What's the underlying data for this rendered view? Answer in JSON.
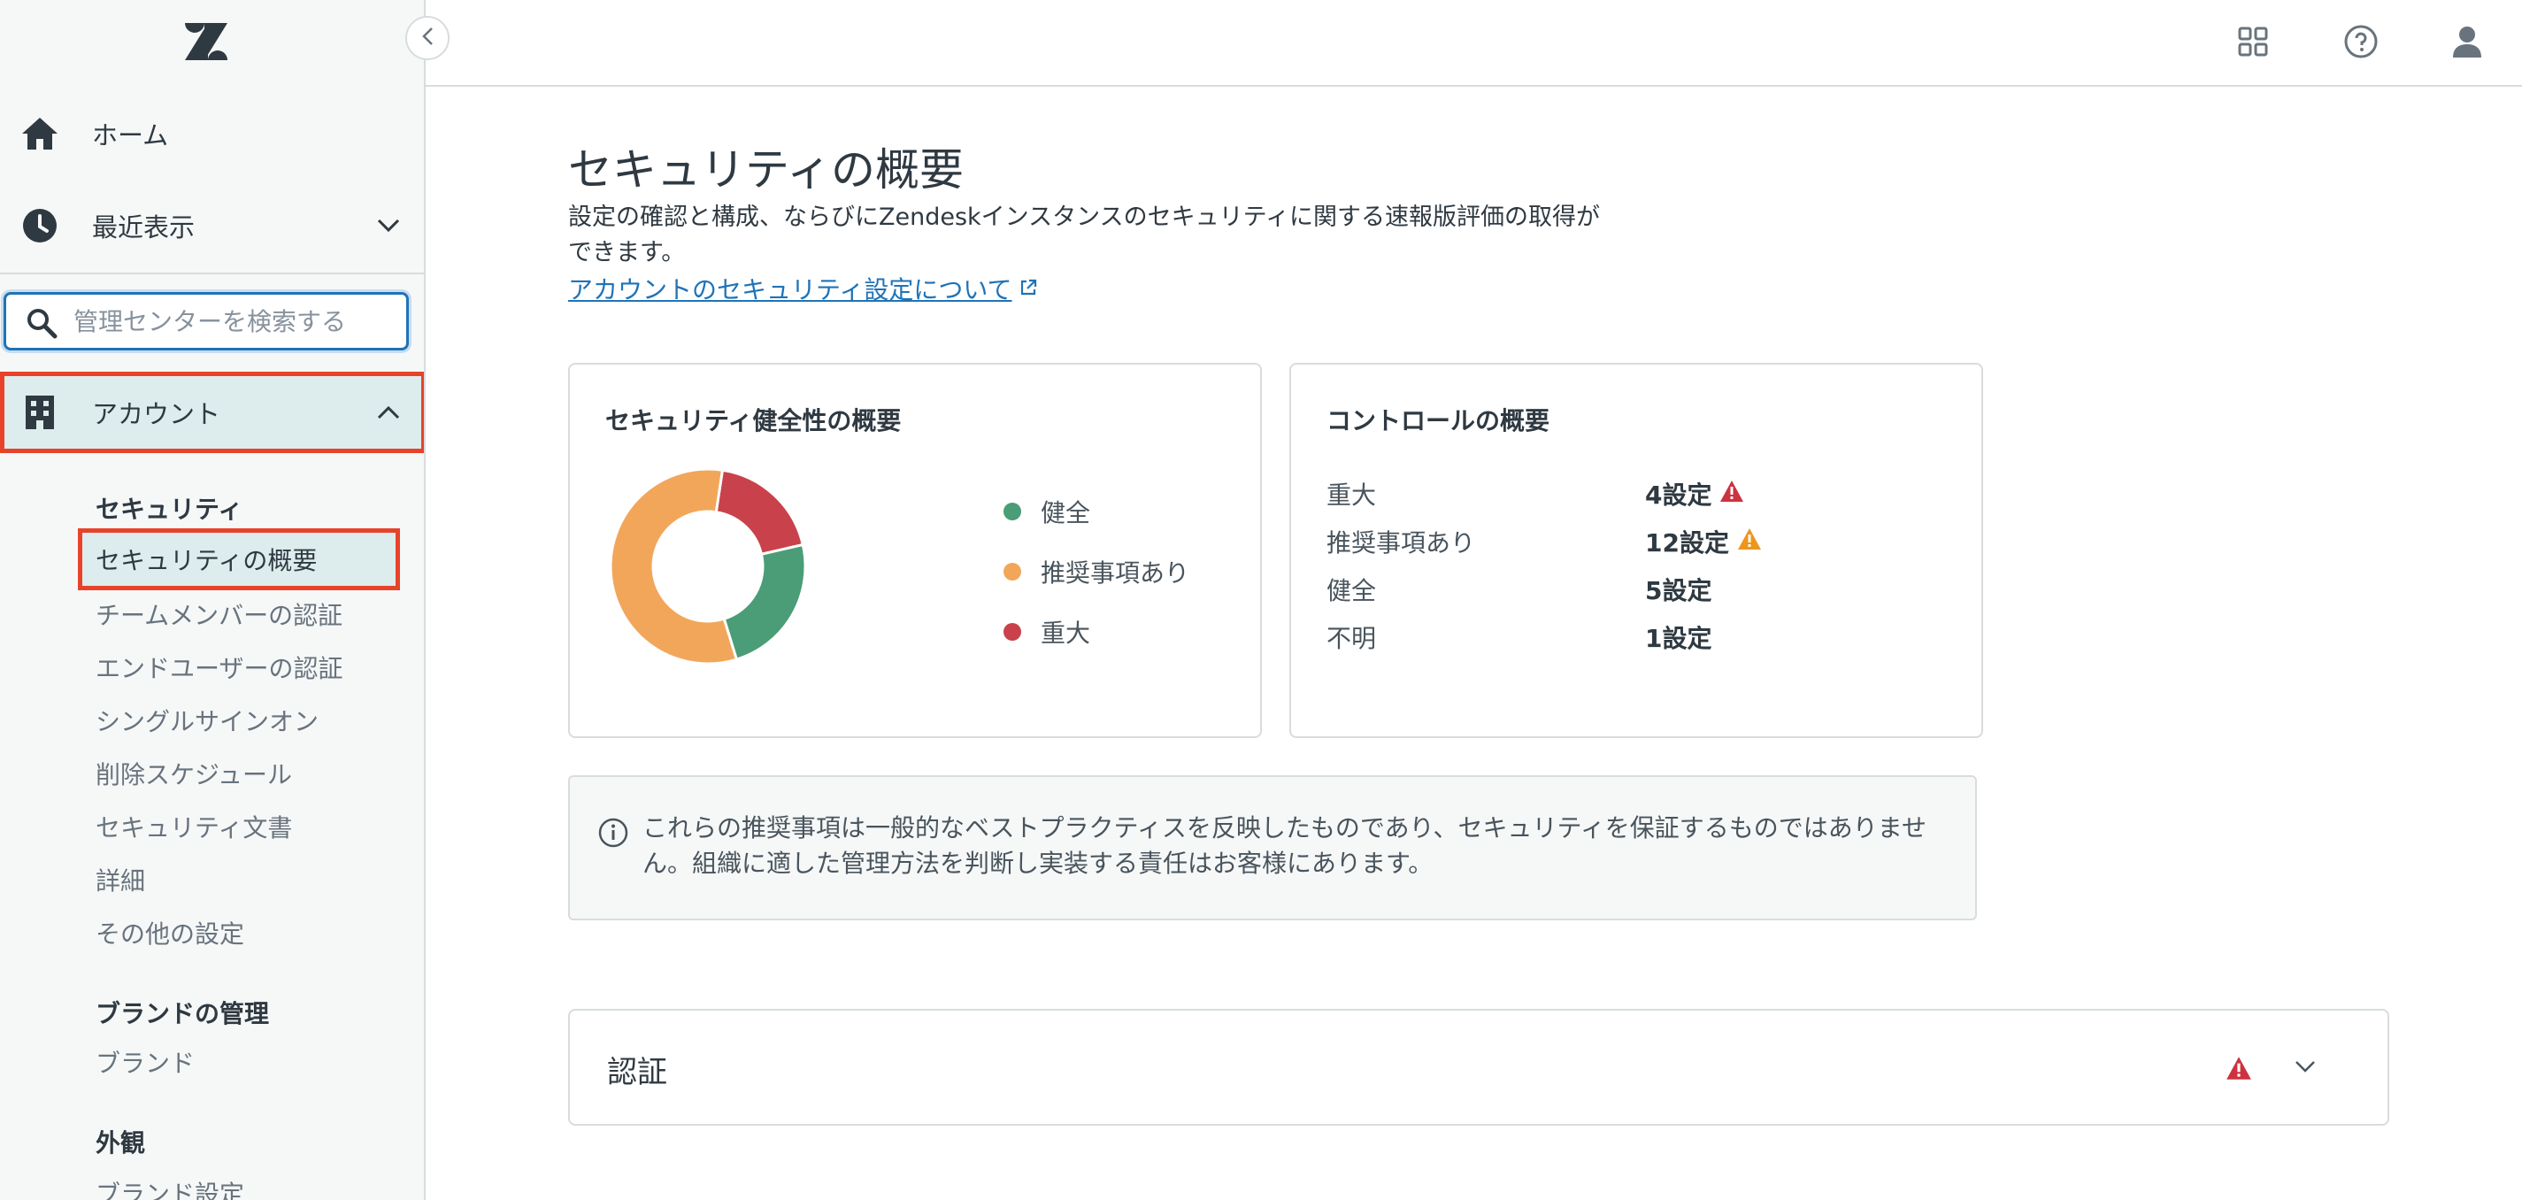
{
  "sidebar": {
    "home_label": "ホーム",
    "recent_label": "最近表示",
    "search_placeholder": "管理センターを検索する",
    "account_label": "アカウント",
    "security_heading": "セキュリティ",
    "security_items": [
      "セキュリティの概要",
      "チームメンバーの認証",
      "エンドユーザーの認証",
      "シングルサインオン",
      "削除スケジュール",
      "セキュリティ文書",
      "詳細",
      "その他の設定"
    ],
    "brand_heading": "ブランドの管理",
    "brand_items": [
      "ブランド"
    ],
    "appearance_heading": "外観",
    "appearance_items": [
      "ブランド設定"
    ]
  },
  "topbar": {
    "icons": [
      "products-grid-icon",
      "help-icon",
      "user-icon"
    ]
  },
  "main": {
    "title": "セキュリティの概要",
    "description": "設定の確認と構成、ならびにZendeskインスタンスのセキュリティに関する速報版評価の取得ができます。",
    "link_label": "アカウントのセキュリティ設定について",
    "health_card": {
      "title": "セキュリティ健全性の概要",
      "legend": [
        {
          "label": "健全",
          "color": "#4a9d76"
        },
        {
          "label": "推奨事項あり",
          "color": "#f2a65a"
        },
        {
          "label": "重大",
          "color": "#c9424b"
        }
      ]
    },
    "control_card": {
      "title": "コントロールの概要",
      "rows": [
        {
          "label": "重大",
          "value": "4設定",
          "icon": "alert-red-icon"
        },
        {
          "label": "推奨事項あり",
          "value": "12設定",
          "icon": "alert-orange-icon"
        },
        {
          "label": "健全",
          "value": "5設定",
          "icon": ""
        },
        {
          "label": "不明",
          "value": "1設定",
          "icon": ""
        }
      ]
    },
    "notice": "これらの推奨事項は一般的なベストプラクティスを反映したものであり、セキュリティを保証するものではありません。組織に適した管理方法を判断し実装する責任はお客様にあります。",
    "accordion": {
      "title": "認証"
    }
  },
  "chart_data": {
    "type": "pie",
    "categories": [
      "健全",
      "推奨事項あり",
      "重大"
    ],
    "values": [
      5,
      12,
      4
    ],
    "colors": [
      "#4a9d76",
      "#f2a65a",
      "#c9424b"
    ],
    "donut": true,
    "legend": "right"
  }
}
